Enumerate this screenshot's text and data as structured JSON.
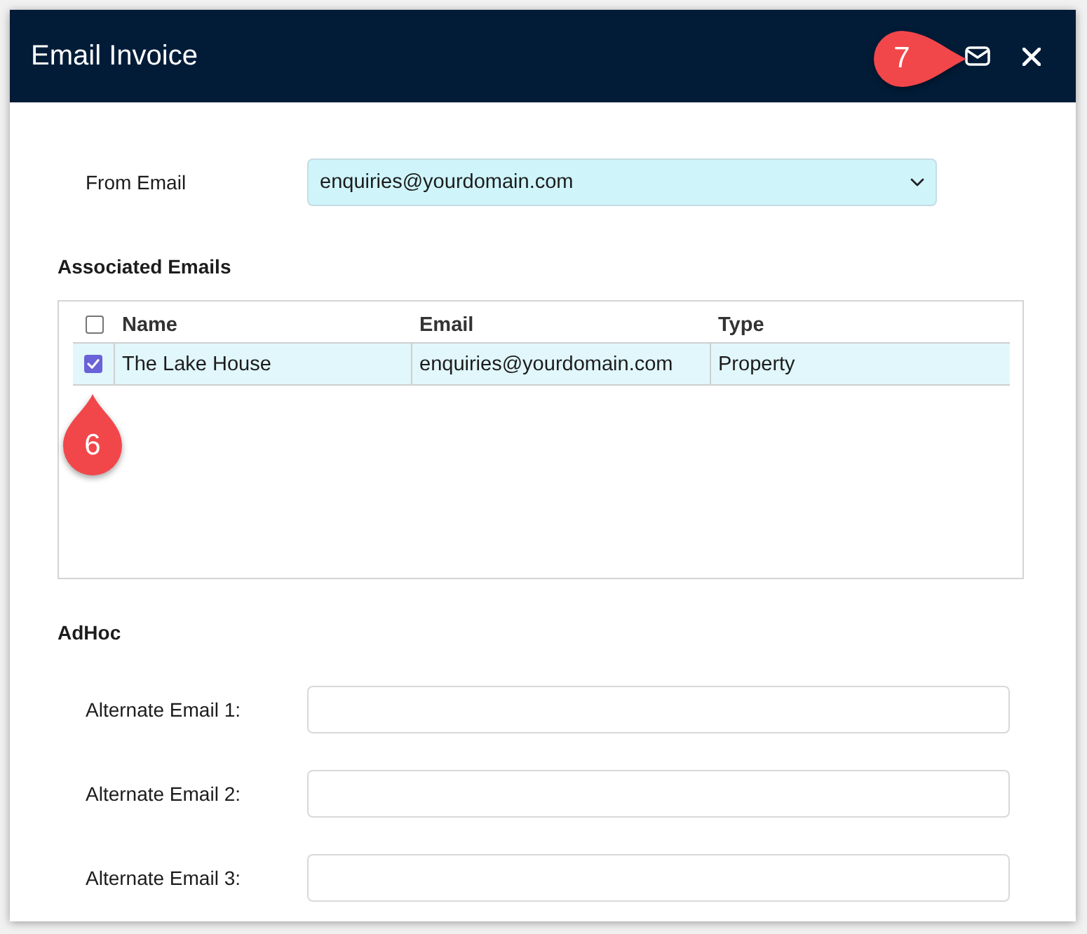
{
  "window": {
    "title": "Email Invoice"
  },
  "header": {
    "callout": {
      "label": "7"
    }
  },
  "from_email": {
    "label": "From Email",
    "value": "enquiries@yourdomain.com"
  },
  "associated_emails": {
    "title": "Associated Emails",
    "select_all": {
      "checked": false
    },
    "columns": [
      "Name",
      "Email",
      "Type"
    ],
    "rows": [
      {
        "checked": true,
        "selected": true,
        "cells": [
          "The Lake House",
          "enquiries@yourdomain.com",
          "Property"
        ]
      }
    ],
    "callout": {
      "label": "6"
    }
  },
  "adhoc": {
    "title": "AdHoc",
    "fields": [
      {
        "label": "Alternate Email 1:"
      },
      {
        "label": "Alternate Email 2:"
      },
      {
        "label": "Alternate Email 3:"
      }
    ]
  }
}
